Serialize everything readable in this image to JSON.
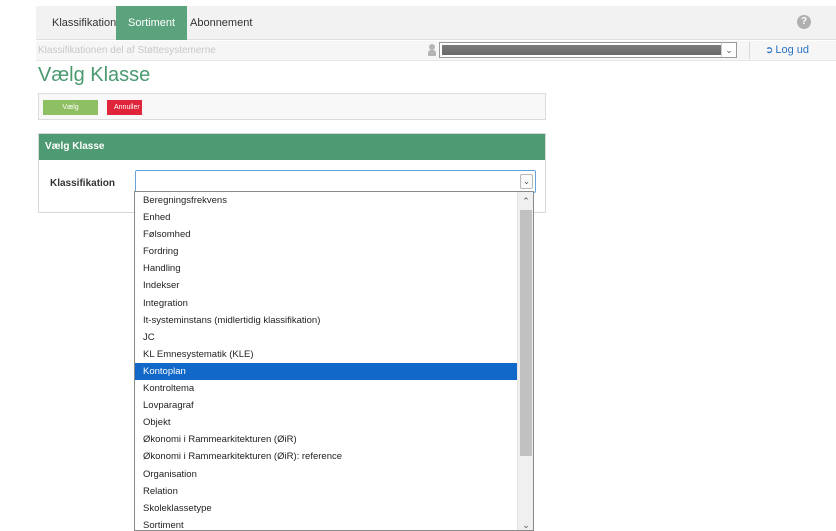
{
  "nav": {
    "tabs": [
      {
        "label": "Klassifikation",
        "active": false
      },
      {
        "label": "Sortiment",
        "active": true
      },
      {
        "label": "Abonnement",
        "active": false
      }
    ],
    "help_icon": "question-circle-icon"
  },
  "subbar": {
    "text": "Klassifikationen del af Støttesystemerne",
    "logout_label": "Log ud",
    "logout_icon": "sign-out-icon",
    "user_icon": "user-icon"
  },
  "page": {
    "title": "Vælg Klasse"
  },
  "buttons": {
    "primary": "Vælg",
    "danger": "Annuller"
  },
  "panel": {
    "header": "Vælg Klasse",
    "field_label": "Klassifikation",
    "select_value": ""
  },
  "dropdown": {
    "selected_index": 10,
    "options": [
      "Beregningsfrekvens",
      "Enhed",
      "Følsomhed",
      "Fordring",
      "Handling",
      "Indekser",
      "Integration",
      "It-systeminstans (midlertidig klassifikation)",
      "JC",
      "KL Emnesystematik (KLE)",
      "Kontoplan",
      "Kontroltema",
      "Lovparagraf",
      "Objekt",
      "Økonomi i Rammearkitekturen (ØiR)",
      "Økonomi i Rammearkitekturen (ØiR): reference",
      "Organisation",
      "Relation",
      "Skoleklassetype",
      "Sortiment"
    ]
  },
  "colors": {
    "brand_green": "#5aa37c",
    "title_green": "#4a9a70",
    "primary_button": "#8fbf63",
    "danger_button": "#e0243a",
    "selected_option": "#1268c9",
    "link_blue": "#2a73c2"
  }
}
